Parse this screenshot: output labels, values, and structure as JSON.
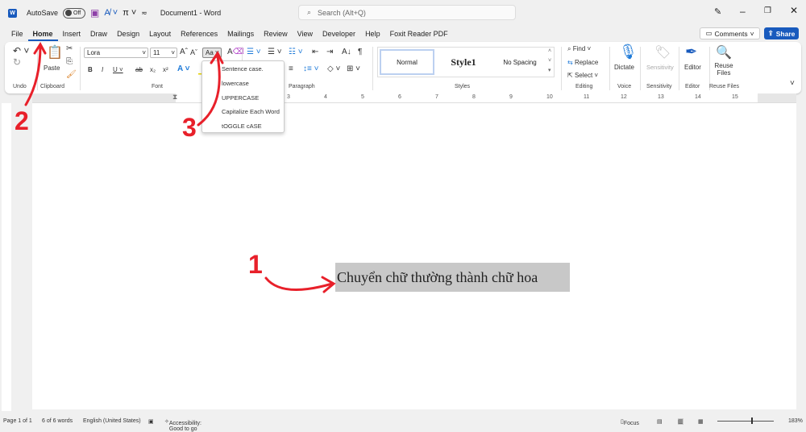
{
  "titlebar": {
    "autosave": "AutoSave",
    "toggle": "Off",
    "doc_title": "Document1  -  Word",
    "search_placeholder": "Search (Alt+Q)"
  },
  "menu": [
    "File",
    "Home",
    "Insert",
    "Draw",
    "Design",
    "Layout",
    "References",
    "Mailings",
    "Review",
    "View",
    "Developer",
    "Help",
    "Foxit Reader PDF"
  ],
  "comments": "Comments",
  "share": "Share",
  "ribbon": {
    "groups": {
      "undo": "Undo",
      "clipboard": "Clipboard",
      "font": "Font",
      "paragraph": "Paragraph",
      "styles": "Styles",
      "editing": "Editing",
      "voice": "Voice",
      "sensitivity": "Sensitivity",
      "editor": "Editor",
      "reuse": "Reuse Files"
    },
    "paste": "Paste",
    "font_name": "Lora",
    "font_size": "11",
    "change_case": "Aa",
    "styles": [
      "Normal",
      "Style1",
      "No Spacing"
    ],
    "find": "Find",
    "replace": "Replace",
    "select": "Select",
    "dictate": "Dictate",
    "sensitivity_btn": "Sensitivity",
    "editor_btn": "Editor",
    "reuse_btn": "Reuse Files"
  },
  "case_menu": [
    "Sentence case.",
    "lowercase",
    "UPPERCASE",
    "Capitalize Each Word",
    "tOGGLE cASE"
  ],
  "ruler": [
    "1",
    "2",
    "3",
    "4",
    "5",
    "6",
    "7",
    "8",
    "9",
    "10",
    "11",
    "12",
    "13",
    "14",
    "15"
  ],
  "document": {
    "text": "Chuyển chữ thường thành chữ hoa"
  },
  "annotations": [
    "1",
    "2",
    "3"
  ],
  "annotation_color": "#e8202a",
  "status": {
    "page": "Page 1 of 1",
    "words": "6 of 6 words",
    "language": "English (United States)",
    "accessibility": "Accessibility: Good to go",
    "focus": "Focus",
    "zoom": "183%"
  },
  "colors": {
    "accent": "#185abd",
    "word_icon": "#185abd"
  }
}
